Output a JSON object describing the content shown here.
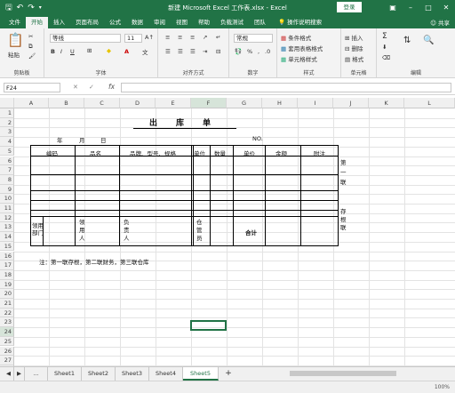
{
  "titlebar": {
    "title": "新建 Microsoft Excel 工作表.xlsx  -  Excel",
    "login": "登录",
    "icons": [
      "save-icon",
      "undo-icon",
      "redo-icon",
      "customize-icon"
    ]
  },
  "ribbon_tabs": [
    "文件",
    "开始",
    "插入",
    "页面布局",
    "公式",
    "数据",
    "审阅",
    "视图",
    "帮助",
    "负载测试",
    "团队"
  ],
  "tell_me": "操作说明搜索",
  "share": "共享",
  "ribbon": {
    "clipboard": {
      "paste": "粘贴",
      "label": "剪贴板"
    },
    "font": {
      "name": "等线",
      "size": "11",
      "bold": "B",
      "italic": "I",
      "underline": "U",
      "label": "字体"
    },
    "alignment": {
      "label": "对齐方式"
    },
    "number": {
      "format": "常规",
      "label": "数字"
    },
    "styles": {
      "conditional": "条件格式",
      "table": "套用表格格式",
      "cell": "单元格样式",
      "label": "样式"
    },
    "cells": {
      "insert": "插入",
      "delete": "删除",
      "format": "格式",
      "label": "单元格"
    },
    "editing": {
      "label": "编辑"
    }
  },
  "formula_bar": {
    "name_box": "F24",
    "value": ""
  },
  "columns": [
    "A",
    "B",
    "C",
    "D",
    "E",
    "F",
    "G",
    "H",
    "I",
    "J",
    "K",
    "L"
  ],
  "rows": [
    "1",
    "2",
    "3",
    "4",
    "5",
    "6",
    "7",
    "8",
    "9",
    "10",
    "11",
    "12",
    "13",
    "14",
    "15",
    "16",
    "17",
    "18",
    "19",
    "20",
    "21",
    "22",
    "23",
    "24",
    "25",
    "26",
    "27",
    "28"
  ],
  "sheet": {
    "title": "出　　库　　单",
    "date": {
      "year": "年",
      "month": "月",
      "day": "日"
    },
    "no": "NO.",
    "headers": [
      "编码",
      "品名",
      "品牌、型号、规格",
      "单位",
      "数量",
      "单价",
      "金额",
      "附注"
    ],
    "side1": "第一联",
    "side2": "存根联",
    "footer_labels": {
      "receiver_dept": "领用部门",
      "receiver": "领用人",
      "manager": "负责人",
      "keeper": "仓管员",
      "total": "合计"
    },
    "note": "注：第一联存根，第二联财务，第三联仓库"
  },
  "sheet_tabs": [
    "Sheet1",
    "Sheet2",
    "Sheet3",
    "Sheet4",
    "Sheet5"
  ],
  "active_sheet": "Sheet5",
  "add_sheet": "+",
  "status_right": "100%"
}
